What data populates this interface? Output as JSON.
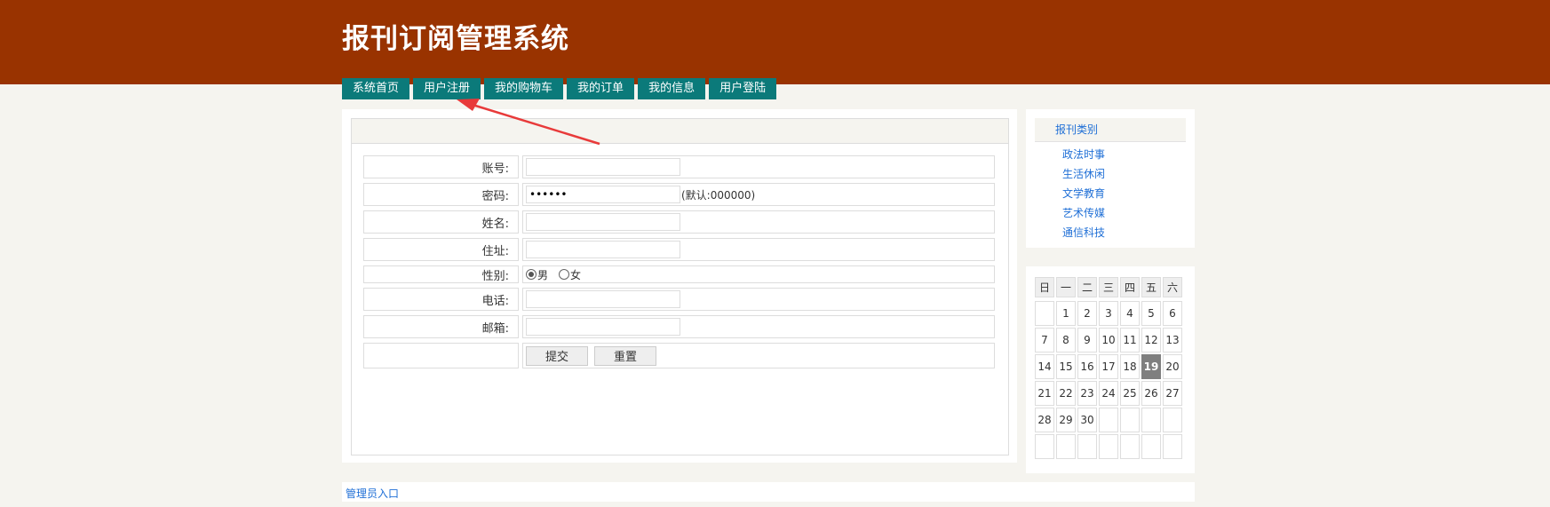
{
  "header": {
    "title": "报刊订阅管理系统"
  },
  "nav": [
    {
      "label": "系统首页"
    },
    {
      "label": "用户注册"
    },
    {
      "label": "我的购物车"
    },
    {
      "label": "我的订单"
    },
    {
      "label": "我的信息"
    },
    {
      "label": "用户登陆"
    }
  ],
  "form": {
    "account_label": "账号:",
    "password_label": "密码:",
    "password_value": "000000",
    "password_hint": "(默认:000000)",
    "name_label": "姓名:",
    "address_label": "住址:",
    "gender_label": "性别:",
    "gender_male": "男",
    "gender_female": "女",
    "phone_label": "电话:",
    "email_label": "邮箱:",
    "submit_label": "提交",
    "reset_label": "重置"
  },
  "categories": {
    "title": "报刊类别",
    "items": [
      {
        "label": "政法时事"
      },
      {
        "label": "生活休闲"
      },
      {
        "label": "文学教育"
      },
      {
        "label": "艺术传媒"
      },
      {
        "label": "通信科技"
      }
    ]
  },
  "calendar": {
    "weekdays": [
      "日",
      "一",
      "二",
      "三",
      "四",
      "五",
      "六"
    ],
    "weeks": [
      [
        "",
        "1",
        "2",
        "3",
        "4",
        "5",
        "6"
      ],
      [
        "7",
        "8",
        "9",
        "10",
        "11",
        "12",
        "13"
      ],
      [
        "14",
        "15",
        "16",
        "17",
        "18",
        "19",
        "20"
      ],
      [
        "21",
        "22",
        "23",
        "24",
        "25",
        "26",
        "27"
      ],
      [
        "28",
        "29",
        "30",
        "",
        "",
        "",
        ""
      ],
      [
        "",
        "",
        "",
        "",
        "",
        "",
        ""
      ]
    ],
    "today": "19"
  },
  "footer": {
    "admin_link": "管理员入口"
  },
  "colors": {
    "header_bg": "#993300",
    "nav_bg": "#0b7a7a",
    "link": "#1f6fd6",
    "annotation_arrow": "#e83a3a"
  }
}
